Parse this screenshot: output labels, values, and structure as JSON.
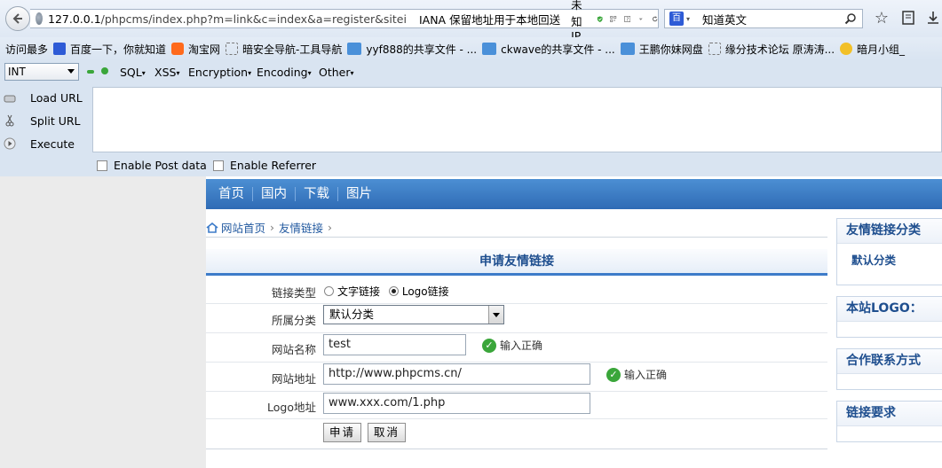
{
  "urlbar": {
    "url_prefix": "127.0.0.1",
    "url_rest": "/phpcms/index.php?m=link&c=index&a=register&sitei",
    "url_extra": "IANA 保留地址用于本地回送",
    "ip_label": "未知IP",
    "search_text": "知道英文"
  },
  "bookmarks": [
    {
      "label": "访问最多",
      "icon": "page"
    },
    {
      "label": "百度一下，你就知道",
      "icon": "baidu"
    },
    {
      "label": "淘宝网",
      "icon": "taobao"
    },
    {
      "label": "暗安全导航-工具导航",
      "icon": "dash"
    },
    {
      "label": "yyf888的共享文件 - ...",
      "icon": "ct"
    },
    {
      "label": "ckwave的共享文件 - ...",
      "icon": "ct"
    },
    {
      "label": "王鹏你妹网盘",
      "icon": "ct"
    },
    {
      "label": "缘分技术论坛 原涛涛...",
      "icon": "dash"
    },
    {
      "label": "暗月小组_",
      "icon": "star"
    }
  ],
  "hackbar": {
    "select_value": "INT",
    "menus": [
      "SQL",
      "XSS",
      "Encryption",
      "Encoding",
      "Other"
    ],
    "load_url": "Load URL",
    "split_url": "Split URL",
    "execute": "Execute",
    "enable_post": "Enable Post data",
    "enable_referrer": "Enable Referrer"
  },
  "nav": [
    "首页",
    "国内",
    "下载",
    "图片"
  ],
  "breadcrumb": {
    "home": "网站首页",
    "current": "友情链接"
  },
  "form": {
    "title": "申请友情链接",
    "link_type_label": "链接类型",
    "radio_text": "文字链接",
    "radio_logo": "Logo链接",
    "category_label": "所属分类",
    "category_value": "默认分类",
    "site_name_label": "网站名称",
    "site_name_value": "test",
    "site_url_label": "网站地址",
    "site_url_value": "http://www.phpcms.cn/",
    "logo_label": "Logo地址",
    "logo_value": "www.xxx.com/1.php",
    "ok_text": "输入正确",
    "submit": "申请",
    "cancel": "取消"
  },
  "sidebar": {
    "link_category_title": "友情链接分类",
    "link_category_item": "默认分类",
    "logo_title": "本站LOGO：",
    "contact_title": "合作联系方式",
    "requirements_title": "链接要求"
  },
  "colors": {
    "nav_bar": "#3a7bc6",
    "title_blue": "#1f4f8f",
    "ok_green": "#3aa63a"
  }
}
